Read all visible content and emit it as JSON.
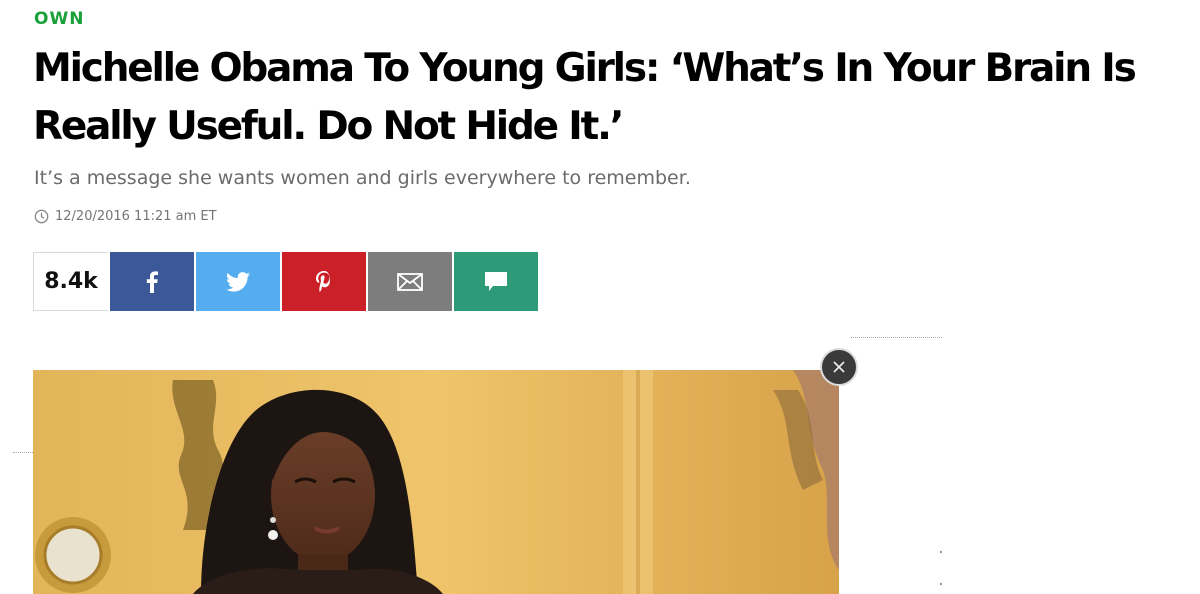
{
  "article": {
    "section": "OWN",
    "headline_line1": "Michelle Obama To Young Girls: ‘What’s In Your Brain Is",
    "headline_line2": "Really Useful. Do Not Hide It.’",
    "subhead": "It’s a message she wants women and girls everywhere to remember.",
    "timestamp": "12/20/2016 11:21 am ET"
  },
  "share": {
    "count": "8.4k",
    "buttons": [
      {
        "network": "facebook",
        "icon": "facebook-icon",
        "color": "#3b5998"
      },
      {
        "network": "twitter",
        "icon": "twitter-icon",
        "color": "#55acee"
      },
      {
        "network": "pinterest",
        "icon": "pinterest-icon",
        "color": "#cb2027"
      },
      {
        "network": "email",
        "icon": "email-icon",
        "color": "#7d7d7d"
      },
      {
        "network": "comments",
        "icon": "comment-icon",
        "color": "#2e9b78"
      }
    ]
  },
  "colors": {
    "section_label": "#1aa13a",
    "headline": "#000000",
    "subhead": "#6b6b6b",
    "timestamp": "#757575"
  },
  "video": {
    "close_icon": "close-icon"
  }
}
